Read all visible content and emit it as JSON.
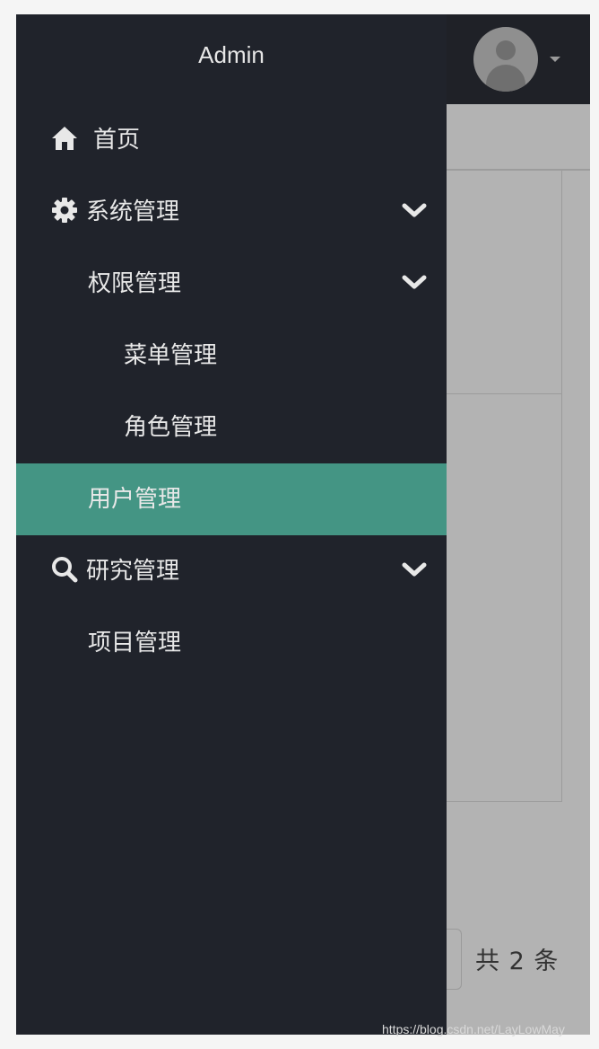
{
  "sidebar": {
    "title": "Admin",
    "items": [
      {
        "label": "首页",
        "icon": "home-icon"
      },
      {
        "label": "系统管理",
        "icon": "gear-icon",
        "expanded": true
      },
      {
        "label": "权限管理",
        "expanded": true
      },
      {
        "label": "菜单管理"
      },
      {
        "label": "角色管理"
      },
      {
        "label": "用户管理",
        "active": true
      },
      {
        "label": "研究管理",
        "icon": "search-icon",
        "expanded": true
      },
      {
        "label": "项目管理"
      }
    ]
  },
  "pagination": {
    "total_text": "共 2 条"
  },
  "watermark": "https://blog.csdn.net/LayLowMay",
  "colors": {
    "sidebar_bg": "#20232b",
    "active_bg": "#449584",
    "overlay": "#b3b3b3"
  }
}
